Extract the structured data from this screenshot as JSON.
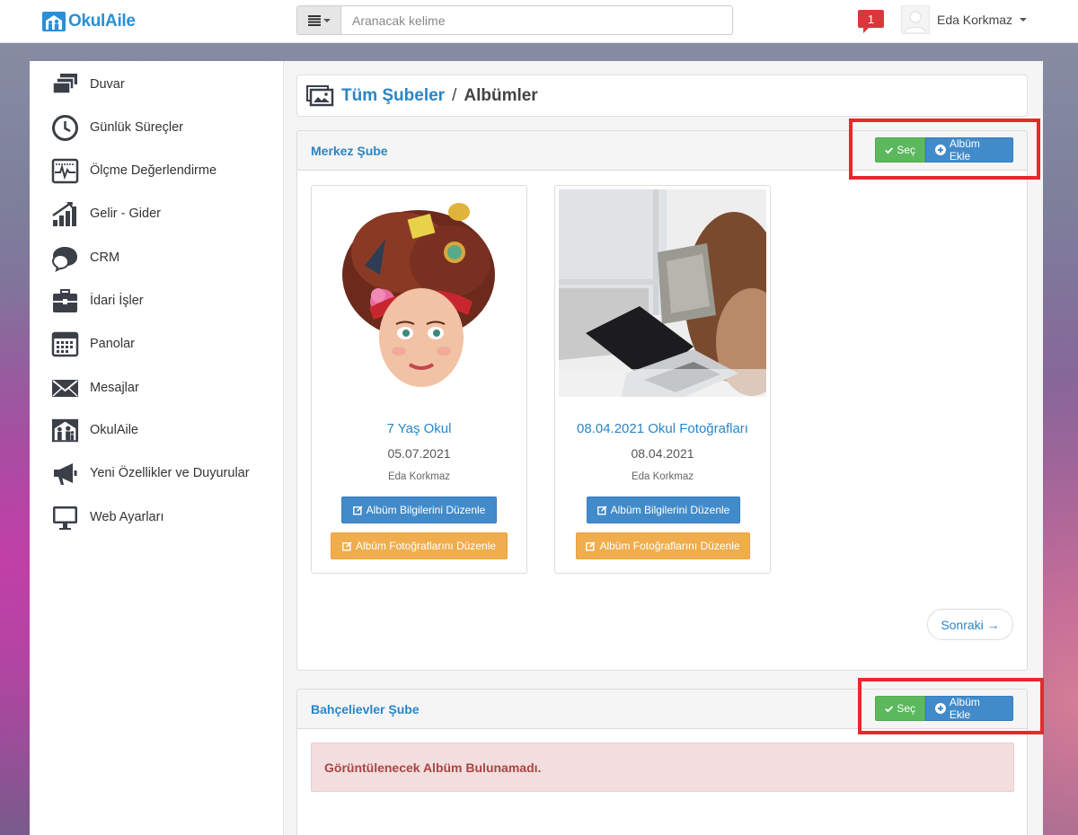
{
  "app": {
    "logo_text": "OkulAile"
  },
  "search": {
    "placeholder": "Aranacak kelime"
  },
  "notifications": {
    "count": "1"
  },
  "user": {
    "name": "Eda Korkmaz"
  },
  "sidebar": {
    "items": [
      {
        "label": "Duvar",
        "icon": "wall-icon"
      },
      {
        "label": "Günlük Süreçler",
        "icon": "clock-icon"
      },
      {
        "label": "Ölçme Değerlendirme",
        "icon": "pulse-icon"
      },
      {
        "label": "Gelir - Gider",
        "icon": "growth-chart-icon"
      },
      {
        "label": "CRM",
        "icon": "chat-bubbles-icon"
      },
      {
        "label": "İdari İşler",
        "icon": "briefcase-icon"
      },
      {
        "label": "Panolar",
        "icon": "calendar-board-icon"
      },
      {
        "label": "Mesajlar",
        "icon": "envelope-icon"
      },
      {
        "label": "OkulAile",
        "icon": "family-icon"
      },
      {
        "label": "Yeni Özellikler ve Duyurular",
        "icon": "megaphone-icon"
      },
      {
        "label": "Web Ayarları",
        "icon": "monitor-icon"
      }
    ]
  },
  "breadcrumb": {
    "parent": "Tüm Şubeler",
    "separator": "/",
    "current": "Albümler"
  },
  "branches": [
    {
      "title": "Merkez Şube",
      "select_label": "Seç",
      "add_label": "Albüm Ekle",
      "albums": [
        {
          "title": "7 Yaş Okul",
          "date": "05.07.2021",
          "owner": "Eda Korkmaz",
          "edit_info_label": "Albüm Bilgilerini Düzenle",
          "edit_photos_label": "Albüm Fotoğraflarını Düzenle"
        },
        {
          "title": "08.04.2021 Okul Fotoğrafları",
          "date": "08.04.2021",
          "owner": "Eda Korkmaz",
          "edit_info_label": "Albüm Bilgilerini Düzenle",
          "edit_photos_label": "Albüm Fotoğraflarını Düzenle"
        }
      ],
      "next_label": "Sonraki →"
    },
    {
      "title": "Bahçelievler Şube",
      "select_label": "Seç",
      "add_label": "Albüm Ekle",
      "empty_message": "Görüntülenecek Albüm Bulunamadı."
    }
  ],
  "colors": {
    "brand": "#2a8fd6",
    "link": "#2a85c7",
    "success": "#5cb85c",
    "primary": "#428bca",
    "warning": "#f0ad4e",
    "danger_text": "#a94442",
    "highlight": "#e8282b"
  }
}
